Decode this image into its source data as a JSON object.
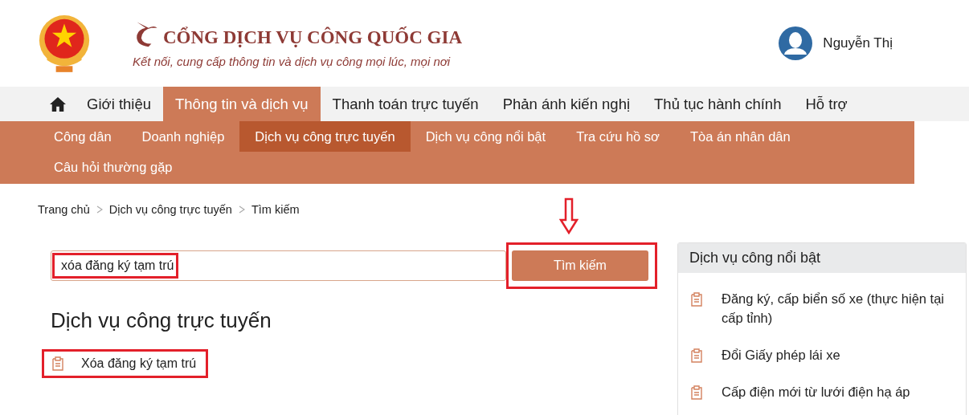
{
  "header": {
    "title": "CỔNG DỊCH VỤ CÔNG QUỐC GIA",
    "slogan": "Kết nối, cung cấp thông tin và dịch vụ công mọi lúc, mọi nơi",
    "user": "Nguyễn Thị"
  },
  "nav": [
    {
      "label": "Giới thiệu",
      "selected": false
    },
    {
      "label": "Thông tin và dịch vụ",
      "selected": true
    },
    {
      "label": "Thanh toán trực tuyến",
      "selected": false
    },
    {
      "label": "Phản ánh kiến nghị",
      "selected": false
    },
    {
      "label": "Thủ tục hành chính",
      "selected": false
    },
    {
      "label": "Hỗ trợ",
      "selected": false
    }
  ],
  "subnav": [
    {
      "label": "Công dân",
      "selected": false
    },
    {
      "label": "Doanh nghiệp",
      "selected": false
    },
    {
      "label": "Dịch vụ công trực tuyến",
      "selected": true
    },
    {
      "label": "Dịch vụ công nổi bật",
      "selected": false
    },
    {
      "label": "Tra cứu hồ sơ",
      "selected": false
    },
    {
      "label": "Tòa án nhân dân",
      "selected": false
    },
    {
      "label": "Câu hỏi thường gặp",
      "selected": false
    }
  ],
  "breadcrumb": [
    "Trang chủ",
    "Dịch vụ công trực tuyến",
    "Tìm kiếm"
  ],
  "search": {
    "value": "xóa đăng ký tạm trú",
    "button": "Tìm kiếm"
  },
  "results": {
    "heading": "Dịch vụ công trực tuyến",
    "items": [
      "Xóa đăng ký tạm trú"
    ]
  },
  "sidebar": {
    "title": "Dịch vụ công nổi bật",
    "items": [
      "Đăng ký, cấp biển số xe (thực hiện tại cấp tỉnh)",
      "Đổi Giấy phép lái xe",
      "Cấp điện mới từ lưới điện hạ áp"
    ]
  }
}
